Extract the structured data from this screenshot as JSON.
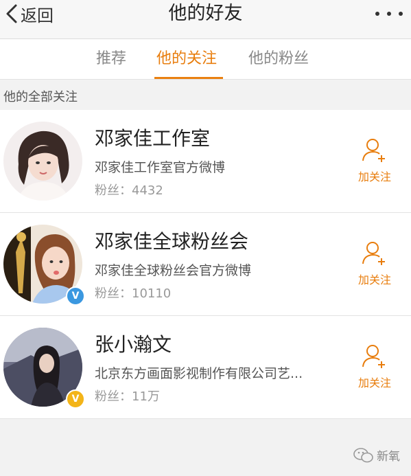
{
  "nav": {
    "back_label": "返回",
    "title": "他的好友"
  },
  "tabs": [
    {
      "label": "推荐",
      "active": false
    },
    {
      "label": "他的关注",
      "active": true
    },
    {
      "label": "他的粉丝",
      "active": false
    }
  ],
  "section": {
    "header": "他的全部关注"
  },
  "users": [
    {
      "name": "邓家佳工作室",
      "desc": "邓家佳工作室官方微博",
      "fans_label": "粉丝：",
      "fans": "4432",
      "verified": "none",
      "follow_label": "加关注"
    },
    {
      "name": "邓家佳全球粉丝会",
      "desc": "邓家佳全球粉丝会官方微博",
      "fans_label": "粉丝：",
      "fans": "10110",
      "verified": "blue",
      "follow_label": "加关注"
    },
    {
      "name": "张小瀚文",
      "desc": "北京东方画面影视制作有限公司艺...",
      "fans_label": "粉丝：",
      "fans": "11万",
      "verified": "gold",
      "follow_label": "加关注"
    }
  ],
  "watermark": {
    "text": "新氧",
    "icon": "wechat-icon"
  },
  "colors": {
    "accent": "#e87d0d",
    "verified_blue": "#3b98e0",
    "verified_gold": "#f3b418"
  }
}
